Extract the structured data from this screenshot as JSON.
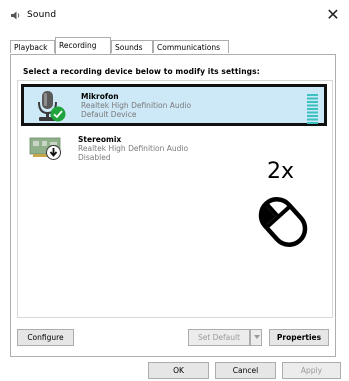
{
  "window": {
    "title": "Sound",
    "close_glyph": "✕"
  },
  "tabs": [
    {
      "label": "Playback",
      "active": false
    },
    {
      "label": "Recording",
      "active": true
    },
    {
      "label": "Sounds",
      "active": false
    },
    {
      "label": "Communications",
      "active": false
    }
  ],
  "instruction": "Select a recording device below to modify its settings:",
  "devices": [
    {
      "name": "Mikrofon",
      "driver": "Realtek High Definition Audio",
      "status": "Default Device",
      "icon": "microphone-icon",
      "badge": "default-check-icon",
      "selected": true
    },
    {
      "name": "Stereomix",
      "driver": "Realtek High Definition Audio",
      "status": "Disabled",
      "icon": "sound-card-icon",
      "badge": "disabled-arrow-icon",
      "selected": false
    }
  ],
  "annotation": {
    "text": "2x",
    "icon": "mouse-double-click-icon"
  },
  "buttons": {
    "configure": "Configure",
    "set_default": "Set Default",
    "properties": "Properties",
    "ok": "OK",
    "cancel": "Cancel",
    "apply": "Apply"
  }
}
